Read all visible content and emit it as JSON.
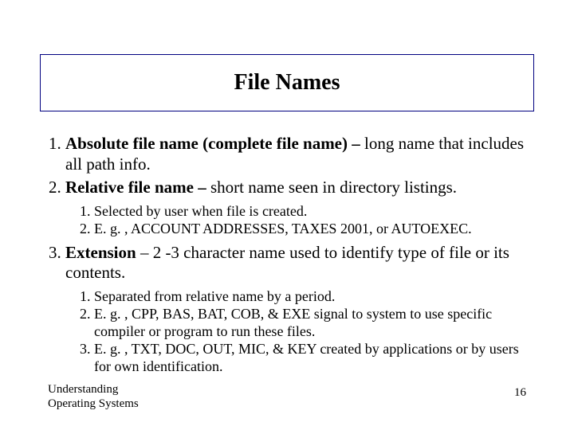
{
  "title": "File Names",
  "items": [
    {
      "term": "Absolute file name (complete file name) – ",
      "desc": "long name that includes all path info."
    },
    {
      "term": "Relative file name – ",
      "desc": " short name seen in directory listings.",
      "sub": [
        "Selected by user when file is created.",
        "E. g. , ACCOUNT ADDRESSES, TAXES 2001, or AUTOEXEC."
      ]
    },
    {
      "term": "Extension",
      "desc": " – 2 -3  character name used to identify type of file or its contents.",
      "sub": [
        "Separated from relative name by a period.",
        "E. g. , CPP, BAS, BAT, COB, & EXE signal to system to use specific compiler or program to run these files.",
        "E. g. , TXT, DOC, OUT, MIC, & KEY  created by applications or by users for own identification."
      ]
    }
  ],
  "footer": {
    "left_line1": "Understanding",
    "left_line2": "Operating Systems",
    "page": "16"
  }
}
